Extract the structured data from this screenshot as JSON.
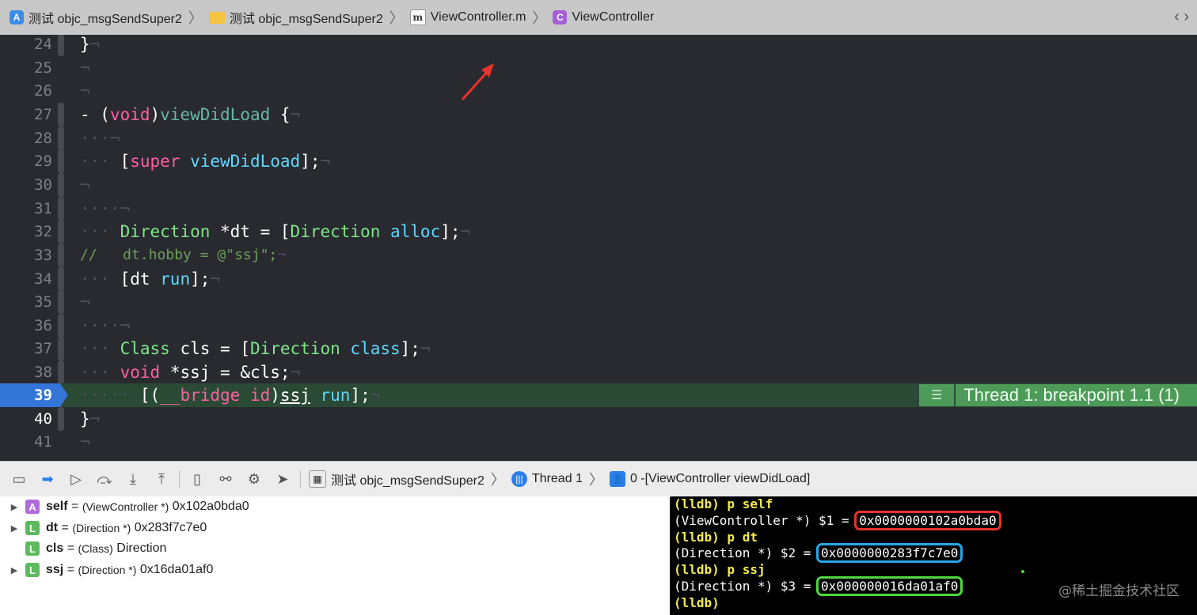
{
  "jumpbar": {
    "crumbs": [
      {
        "label": "测试 objc_msgSendSuper2",
        "icon": "app-icon"
      },
      {
        "label": "测试 objc_msgSendSuper2",
        "icon": "folder-icon"
      },
      {
        "label": "ViewController.m",
        "icon": "m-file-icon"
      },
      {
        "label": "ViewController",
        "icon": "class-c-icon"
      }
    ],
    "nav_arrows": "‹ ›"
  },
  "editor": {
    "line_numbers": [
      "24",
      "25",
      "26",
      "27",
      "28",
      "29",
      "30",
      "31",
      "32",
      "33",
      "34",
      "35",
      "36",
      "37",
      "38",
      "39",
      "40",
      "41"
    ],
    "breakpoint_line": "39",
    "thread_badge": "Thread 1: breakpoint 1.1 (1)"
  },
  "debugbar": {
    "crumb_process": "测试 objc_msgSendSuper2",
    "crumb_thread": "Thread 1",
    "crumb_frame": "0 -[ViewController viewDidLoad]"
  },
  "variables": [
    {
      "badge": "A",
      "name": "self",
      "eq": " = ",
      "type": "(ViewController *)",
      "value": " 0x102a0bda0",
      "expandable": true
    },
    {
      "badge": "L",
      "name": "dt",
      "eq": " = ",
      "type": "(Direction *)",
      "value": " 0x283f7c7e0",
      "expandable": true
    },
    {
      "badge": "L",
      "name": "cls",
      "eq": " = ",
      "type": "(Class)",
      "value": " Direction",
      "expandable": false
    },
    {
      "badge": "L",
      "name": "ssj",
      "eq": " = ",
      "type": "(Direction *)",
      "value": " 0x16da01af0",
      "expandable": true
    }
  ],
  "console": {
    "l1": "(lldb) p self",
    "l2_prefix": "(ViewController *) $1 = ",
    "l2_value": "0x0000000102a0bda0",
    "l3": "(lldb) p dt",
    "l4_prefix": "(Direction *) $2 = ",
    "l4_value": "0x0000000283f7c7e0",
    "l5": "(lldb) p ssj",
    "l6_prefix": "(Direction *) $3 = ",
    "l6_value": "0x000000016da01af0",
    "l7": "(lldb)",
    "watermark": "@稀土掘金技术社区"
  },
  "colors": {
    "keyword": "#fc5fa3",
    "class": "#5dd8ff",
    "breakpoint": "#3475d8",
    "thread_badge": "#4d9a59"
  }
}
